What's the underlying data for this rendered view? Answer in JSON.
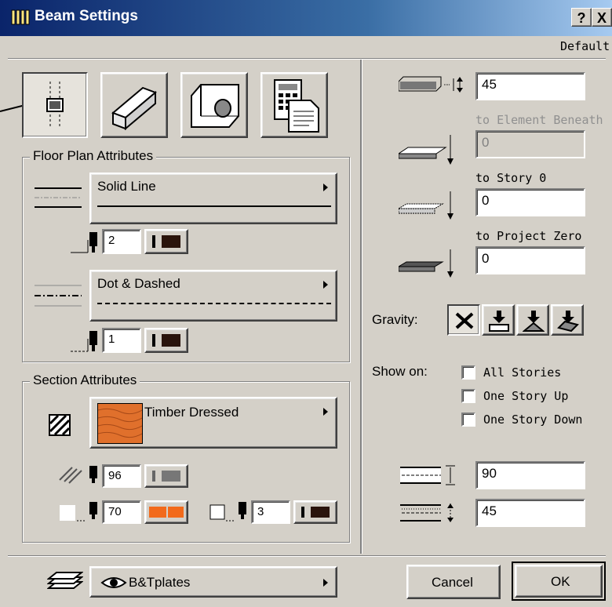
{
  "window": {
    "title": "Beam Settings",
    "help_label": "?",
    "close_label": "X",
    "default_label": "Default"
  },
  "tabs": [
    {
      "name": "floor-plan-tab",
      "selected": true
    },
    {
      "name": "3d-model-tab",
      "selected": false
    },
    {
      "name": "section-tab",
      "selected": false
    },
    {
      "name": "listing-tab",
      "selected": false
    }
  ],
  "floor_plan": {
    "group_label": "Floor Plan Attributes",
    "line1": {
      "label": "Solid Line",
      "pen": "2"
    },
    "line2": {
      "label": "Dot & Dashed",
      "pen": "1"
    }
  },
  "section": {
    "group_label": "Section Attributes",
    "fill_label": "Timber Dressed",
    "fill_pen": "96",
    "background_pen": "70",
    "contour_pen": "3",
    "fill_color": "#e0702c"
  },
  "right": {
    "height": "45",
    "to_element_label": "to Element Beneath",
    "to_element_value": "0",
    "to_story_label": "to Story 0",
    "to_story_value": "0",
    "to_project_label": "to Project Zero",
    "to_project_value": "0",
    "gravity_label": "Gravity:",
    "show_on_label": "Show on:",
    "show_options": [
      {
        "label": "All Stories",
        "checked": false
      },
      {
        "label": "One Story Up",
        "checked": false
      },
      {
        "label": "One Story Down",
        "checked": false
      }
    ],
    "width": "90",
    "offset": "45"
  },
  "footer": {
    "layer": "B&Tplates",
    "cancel": "Cancel",
    "ok": "OK"
  }
}
